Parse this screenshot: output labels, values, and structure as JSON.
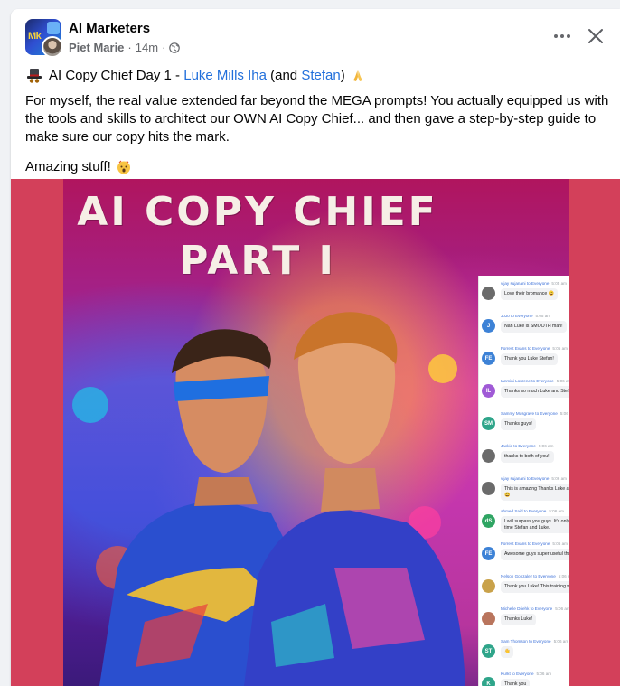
{
  "post": {
    "group_name": "AI Marketers",
    "author": "Piet Marie",
    "time": "14m",
    "separator": "·",
    "title_prefix": "AI Copy Chief Day 1 -",
    "title_link1": "Luke Mills Iha",
    "title_mid": "(and",
    "title_link2": "Stefan",
    "title_end": ")",
    "paragraph": "For myself, the real value extended far beyond the MEGA prompts!  You actually equipped us with the tools and skills to architect our OWN AI Copy Chief... and then gave a step-by-step guide to make sure our copy hits the mark.",
    "paragraph2": "Amazing stuff!",
    "icons": [
      "group-avatar",
      "user-avatar",
      "globe-icon",
      "more-icon",
      "close-icon",
      "hat-icon",
      "pray-icon",
      "shock-icon"
    ]
  },
  "image": {
    "title_line1": "AI COPY CHIEF",
    "title_line2": "PART I",
    "group_avatar_text": "Mk",
    "chat": [
      {
        "initials": "",
        "color": "#6b6b6b",
        "head": "vijay sujanani to Everyone",
        "time": "5:05 am",
        "msg": "Love their bromance 😄"
      },
      {
        "initials": "J",
        "color": "#3d82d6",
        "head": "JoJo to Everyone",
        "time": "5:05 am",
        "msg": "Nah Luke is SMOOTH man!"
      },
      {
        "initials": "FE",
        "color": "#3d82d6",
        "head": "Forrest Evans to Everyone",
        "time": "5:05 am",
        "msg": "Thank you Luke Stefan!"
      },
      {
        "initials": "IL",
        "color": "#a05ad6",
        "head": "Ianmini Lourene to Everyone",
        "time": "5:06 am",
        "msg": "Thanks so much Luke and Stefan ✨"
      },
      {
        "initials": "SM",
        "color": "#2fa58a",
        "head": "Sammy Musgrave to Everyone",
        "time": "5:06 am",
        "msg": "Thanks guys!"
      },
      {
        "initials": "",
        "color": "#6b6b6b",
        "head": "Jackie to Everyone",
        "time": "5:06 am",
        "msg": "thanks to both of you!!"
      },
      {
        "initials": "",
        "color": "#6b6b6b",
        "head": "vijay sujanani to Everyone",
        "time": "5:06 am",
        "msg": "This is amazing  Thanks Luke and Stefan 😄"
      },
      {
        "initials": "dS",
        "color": "#2fa563",
        "head": "ahmed Said to Everyone",
        "time": "5:06 am",
        "msg": "I will surpass you guys. It's only a matter of time Stefan and Luke."
      },
      {
        "initials": "FE",
        "color": "#3d82d6",
        "head": "Forrest Evans to Everyone",
        "time": "5:06 am",
        "msg": "Awesome guys super useful thank you"
      },
      {
        "initials": "",
        "color": "#c9a24a",
        "head": "Nelson Gonzalez to Everyone",
        "time": "5:06 am",
        "msg": "Thank you Luke! This training was gold"
      },
      {
        "initials": "",
        "color": "#b9755d",
        "head": "Michelle Driehk to Everyone",
        "time": "5:06 am",
        "msg": "Thanks Luke!"
      },
      {
        "initials": "ST",
        "color": "#2fa58a",
        "head": "Sam Thomson to Everyone",
        "time": "5:06 am",
        "msg": "👋"
      },
      {
        "initials": "K",
        "color": "#2fa58a",
        "head": "Kurkt to Everyone",
        "time": "5:06 am",
        "msg": "Thank you"
      }
    ]
  },
  "colors": {
    "link": "#216fdb",
    "meta": "#65676b",
    "image_bg": "#d3405a"
  }
}
